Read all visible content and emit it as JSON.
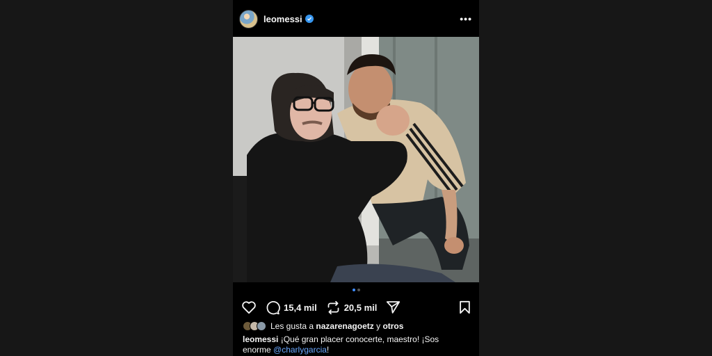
{
  "post": {
    "username": "leomessi",
    "verified": true,
    "more_icon": "more-horizontal-icon",
    "carousel": {
      "count": 2,
      "active": 0
    },
    "actions": {
      "comments": "15,4 mil",
      "reposts": "20,5 mil"
    },
    "likes": {
      "prefix": "Les gusta a",
      "user": "nazarenagoetz",
      "connector": "y",
      "others": "otros"
    },
    "caption": {
      "user": "leomessi",
      "text": "¡Qué gran placer conocerte, maestro! ¡Sos enorme",
      "mention": "@charlygarcia",
      "suffix": "!"
    }
  },
  "colors": {
    "background": "#171717",
    "post": "#000000",
    "accent": "#3897f0",
    "mention": "#6aa8ff"
  }
}
